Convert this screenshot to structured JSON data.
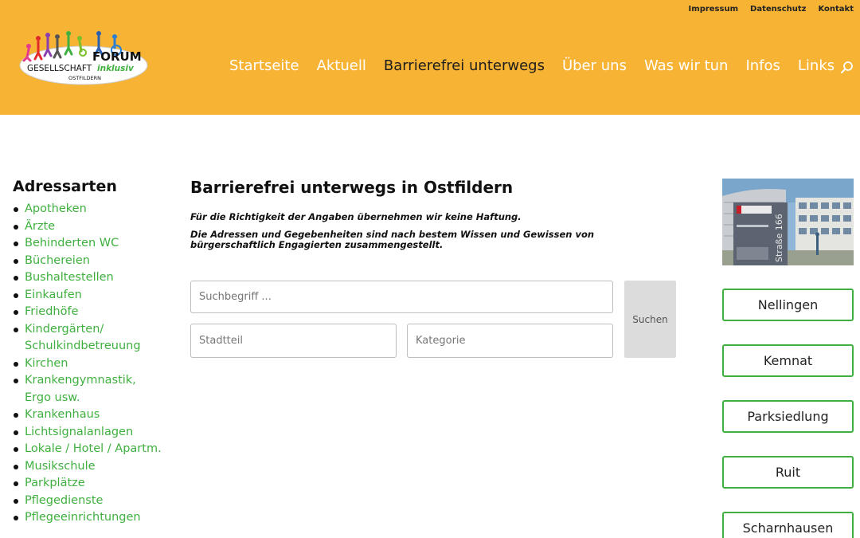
{
  "colors": {
    "header_bg": "#f7b334",
    "accent_green": "#3fb03f",
    "nav_active": "#1d1d1d"
  },
  "topnav": [
    "Impressum",
    "Datenschutz",
    "Kontakt"
  ],
  "logo": {
    "line1": "FORUM",
    "line2_a": "GESELLSCHAFT",
    "line2_b": "inklusiv",
    "line3": "OSTFILDERN"
  },
  "mainnav": [
    {
      "label": "Startseite",
      "active": false
    },
    {
      "label": "Aktuell",
      "active": false
    },
    {
      "label": "Barrierefrei unterwegs",
      "active": true
    },
    {
      "label": "Über uns",
      "active": false
    },
    {
      "label": "Was wir tun",
      "active": false
    },
    {
      "label": "Infos",
      "active": false
    },
    {
      "label": "Links",
      "active": false
    }
  ],
  "sidebar": {
    "title": "Adressarten",
    "items": [
      "Apotheken",
      "Ärzte",
      "Behinderten WC",
      "Büchereien",
      "Bushaltestellen",
      "Einkaufen",
      "Friedhöfe",
      "Kindergärten/ Schulkindbetreuung",
      "Kirchen",
      "Krankengymnastik, Ergo usw.",
      "Krankenhaus",
      "Lichtsignalanlagen",
      "Lokale / Hotel / Apartm.",
      "Musikschule",
      "Parkplätze",
      "Pflegedienste",
      "Pflegeeinrichtungen"
    ]
  },
  "main": {
    "title": "Barrierefrei unterwegs in Ostfildern",
    "disclaimer1": "Für die Richtigkeit der Angaben übernehmen wir keine Haftung.",
    "disclaimer2": "Die Adressen und Gegebenheiten sind nach bestem Wissen und Gewissen von bürgerschaftlich Engagierten zusammengestellt."
  },
  "search": {
    "placeholder": "Suchbegriff ...",
    "district_label": "Stadtteil",
    "category_label": "Kategorie",
    "button_label": "Suchen"
  },
  "photo": {
    "sign_text": "Straße 166"
  },
  "districts": [
    "Nellingen",
    "Kemnat",
    "Parksiedlung",
    "Ruit",
    "Scharnhausen"
  ]
}
